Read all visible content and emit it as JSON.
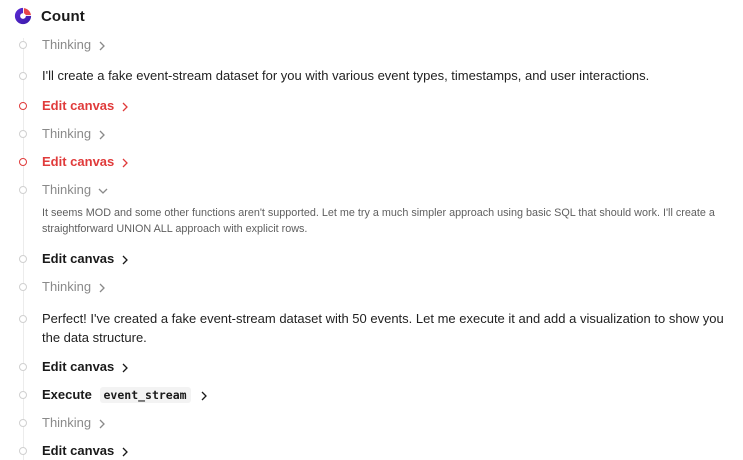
{
  "header": {
    "title": "Count",
    "logo_icon": "count-logo-icon"
  },
  "colors": {
    "accent_red": "#e03b3b",
    "muted": "#8a8a8a"
  },
  "steps": [
    {
      "type": "thinking",
      "label": "Thinking",
      "chevron": "right"
    },
    {
      "type": "message",
      "text": "I'll create a fake event-stream dataset for you with various event types, timestamps, and user interactions."
    },
    {
      "type": "action",
      "label": "Edit canvas",
      "status": "error",
      "chevron": "right"
    },
    {
      "type": "thinking",
      "label": "Thinking",
      "chevron": "right"
    },
    {
      "type": "action",
      "label": "Edit canvas",
      "status": "error",
      "chevron": "right"
    },
    {
      "type": "thinking",
      "label": "Thinking",
      "chevron": "down",
      "expanded_text": "It seems MOD and some other functions aren't supported. Let me try a much simpler approach using basic SQL that should work. I'll create a straightforward UNION ALL approach with explicit rows."
    },
    {
      "type": "action",
      "label": "Edit canvas",
      "chevron": "right"
    },
    {
      "type": "thinking",
      "label": "Thinking",
      "chevron": "right"
    },
    {
      "type": "message",
      "text": "Perfect! I've created a fake event-stream dataset with 50 events. Let me execute it and add a visualization to show you the data structure."
    },
    {
      "type": "action",
      "label": "Edit canvas",
      "chevron": "right"
    },
    {
      "type": "execute",
      "label": "Execute",
      "code": "event_stream",
      "chevron": "right"
    },
    {
      "type": "thinking",
      "label": "Thinking",
      "chevron": "right"
    },
    {
      "type": "action",
      "label": "Edit canvas",
      "chevron": "right"
    }
  ]
}
